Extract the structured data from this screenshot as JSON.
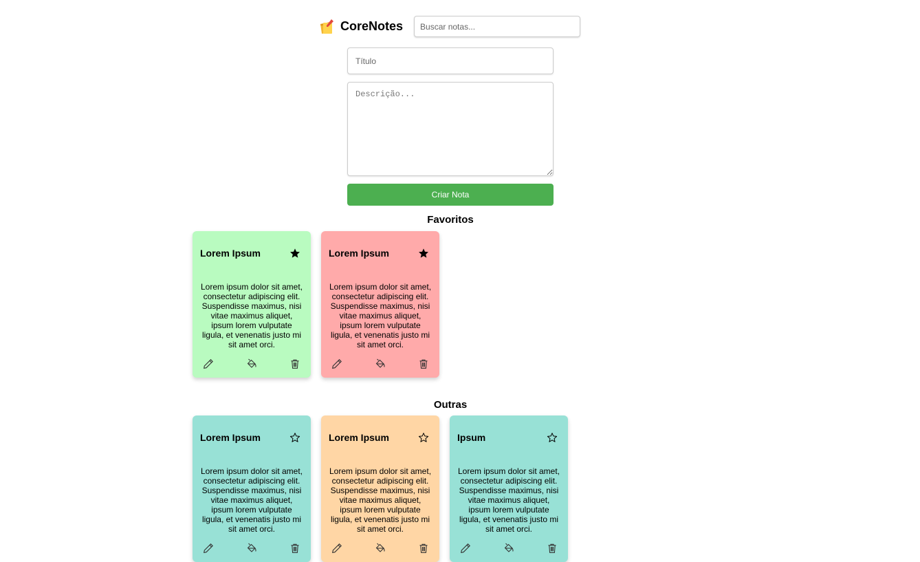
{
  "header": {
    "logo_text": "CoreNotes",
    "search_placeholder": "Buscar notas..."
  },
  "form": {
    "title_placeholder": "Título",
    "description_placeholder": "Descrição...",
    "create_label": "Criar Nota"
  },
  "favorites": {
    "title": "Favoritos",
    "notes": [
      {
        "title": "Lorem Ipsum",
        "body": "Lorem ipsum dolor sit amet, consectetur adipiscing elit. Suspendisse maximus, nisi vitae maximus aliquet, ipsum lorem vulputate ligula, et venenatis justo mi sit amet orci.",
        "color": "#b9fbc0",
        "favorite": true
      },
      {
        "title": "Lorem Ipsum",
        "body": "Lorem ipsum dolor sit amet, consectetur adipiscing elit. Suspendisse maximus, nisi vitae maximus aliquet, ipsum lorem vulputate ligula, et venenatis justo mi sit amet orci.",
        "color": "#ffaaaa",
        "favorite": true
      }
    ]
  },
  "others": {
    "title": "Outras",
    "notes": [
      {
        "title": "Lorem Ipsum",
        "body": "Lorem ipsum dolor sit amet, consectetur adipiscing elit. Suspendisse maximus, nisi vitae maximus aliquet, ipsum lorem vulputate ligula, et venenatis justo mi sit amet orci.",
        "color": "#98e1d6",
        "favorite": false
      },
      {
        "title": "Lorem Ipsum",
        "body": "Lorem ipsum dolor sit amet, consectetur adipiscing elit. Suspendisse maximus, nisi vitae maximus aliquet, ipsum lorem vulputate ligula, et venenatis justo mi sit amet orci.",
        "color": "#ffd6a5",
        "favorite": false
      },
      {
        "title": "Ipsum",
        "body": "Lorem ipsum dolor sit amet, consectetur adipiscing elit. Suspendisse maximus, nisi vitae maximus aliquet, ipsum lorem vulputate ligula, et venenatis justo mi sit amet orci.",
        "color": "#98e1d6",
        "favorite": false
      }
    ]
  },
  "icons": {
    "logo": "memo-icon",
    "favorite_on": "star-filled-icon",
    "favorite_off": "star-outline-icon",
    "edit": "pencil-icon",
    "color": "paint-bucket-icon",
    "delete": "trash-icon"
  }
}
